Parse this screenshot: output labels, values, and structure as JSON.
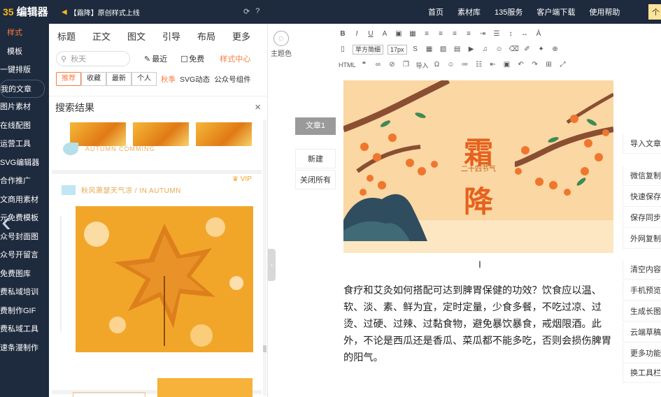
{
  "header": {
    "logo_mark": "35",
    "logo_text": "编辑器",
    "notice": "【霜降】原创样式上线",
    "nav": [
      "首页",
      "素材库",
      "135服务",
      "客户端下载",
      "使用帮助"
    ],
    "user_label": "个"
  },
  "sidebar": {
    "items": [
      "样式",
      "模板",
      "一键排版",
      "我的文章",
      "图片素材",
      "在线配图",
      "运营工具",
      "SVG编辑器",
      "合作推广",
      "文商用素材",
      "元免费模板",
      "众号封面图",
      "众号开留言",
      "免费图库",
      "费私域培训",
      "费制作GIF",
      "费私域工具",
      "速条漫制作"
    ]
  },
  "panel": {
    "tabs": [
      "标题",
      "正文",
      "图文",
      "引导",
      "布局",
      "更多"
    ],
    "search": {
      "placeholder": "秋天"
    },
    "options": {
      "recent": "最近",
      "free": "免费",
      "style_center": "样式中心"
    },
    "filters": [
      "推荐",
      "收藏",
      "最新",
      "个人"
    ],
    "tags": [
      "秋季",
      "SVG动态",
      "公众号组件"
    ],
    "results_title": "搜索结果",
    "close": "×",
    "card1_caption": "AUTUMN COMMING",
    "card2_title": "秋风萧瑟天气凉 / IN AUTUMN",
    "vip_label": "VIP"
  },
  "theme": {
    "label": "主题色"
  },
  "article_tabs": {
    "current": "文章1",
    "new": "新建",
    "close_all": "关闭所有"
  },
  "toolbar": {
    "font_family": "苹方简细",
    "font_size": "17px",
    "html_label": "HTML",
    "import_label": "导入"
  },
  "editor": {
    "hero_title_1": "霜",
    "hero_title_2": "降",
    "hero_small": "二十四节气",
    "body": "食疗和艾灸如何搭配可达到脾胃保健的功效？饮食应以温、软、淡、素、鲜为宜，定时定量，少食多餐，不吃过凉、过烫、过硬、过辣、过黏食物，避免暴饮暴食，戒烟限酒。此外，不论是西瓜还是香瓜、菜瓜都不能多吃，否则会损伤脾胃的阳气。"
  },
  "right_tools": [
    "导入文章",
    "微信复制",
    "快速保存",
    "保存同步",
    "外网复制",
    "清空内容",
    "手机预览",
    "生成长图",
    "云端草稿",
    "更多功能",
    "换工具栏"
  ],
  "colors": {
    "accent": "#f77d3e",
    "dark": "#1e2a3d",
    "gold": "#f5b622"
  }
}
